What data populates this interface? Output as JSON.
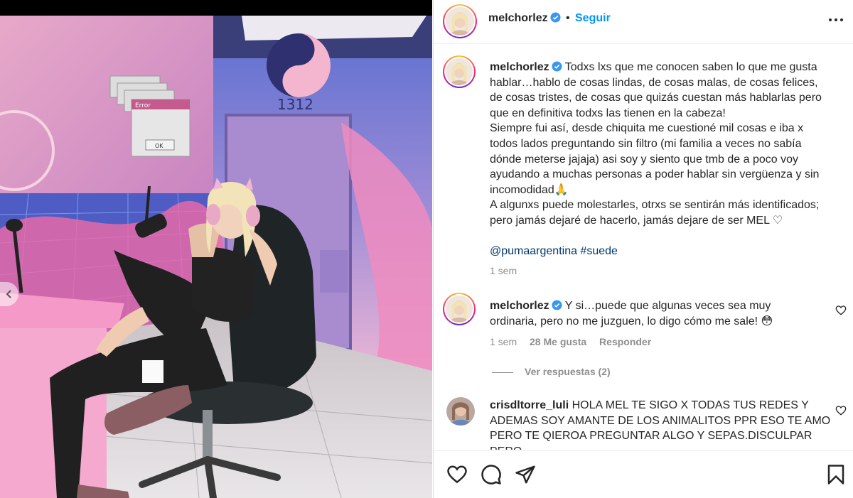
{
  "post": {
    "username": "melchorlez",
    "separator": "•",
    "follow_label": "Seguir",
    "caption_lines": [
      "Todxs lxs que me conocen saben lo que me gusta",
      "hablar…hablo de cosas lindas, de cosas malas, de cosas felices,",
      "de cosas tristes, de cosas que quizás cuestan más hablarlas pero",
      "que en definitiva todxs las tienen en la cabeza!",
      "Siempre fui así, desde chiquita me cuestioné mil cosas e iba x",
      "todos lados preguntando sin filtro (mi familia a veces no sabía",
      "dónde meterse jajaja) asi soy y siento que tmb de a poco voy",
      "ayudando a muchas personas a poder hablar sin vergüenza y sin",
      "incomodidad🙏",
      "A algunxs puede molestarles, otrxs se sentirán más identificados;",
      "pero jamás dejaré de hacerlo, jamás dejare de ser MEL ♡"
    ],
    "tags": "@pumaargentina #suede",
    "time": "1 sem"
  },
  "comments": [
    {
      "username": "melchorlez",
      "text_lines": [
        "Y si…puede que algunas veces sea muy",
        "ordinaria, pero no me juzguen, lo digo cómo me sale! 😳"
      ],
      "time": "1 sem",
      "likes": "28 Me gusta",
      "reply_label": "Responder",
      "view_replies": "Ver respuestas (2)"
    },
    {
      "username": "crisdltorre_luli",
      "text_lines": [
        "HOLA MEL TE SIGO X TODAS TUS REDES Y",
        "ADEMAS SOY AMANTE DE LOS ANIMALITOS PPR ESO TE AMO",
        "PERO TE QIEROA PREGUNTAR ALGO Y SEPAS.DISCULPAR PERO"
      ]
    }
  ],
  "photo": {
    "popup_label_error": "Error",
    "popup_label_ok": "OK",
    "wall_number": "1312"
  },
  "icons": {
    "more": "more-horizontal-icon",
    "like": "heart-icon",
    "comment": "comment-icon",
    "share": "share-icon",
    "save": "bookmark-icon",
    "verified": "verified-badge-icon",
    "prev": "chevron-left-icon"
  },
  "colors": {
    "follow": "#0095f6",
    "verified": "#3897f0",
    "muted": "#8e8e8e",
    "text": "#262626"
  }
}
